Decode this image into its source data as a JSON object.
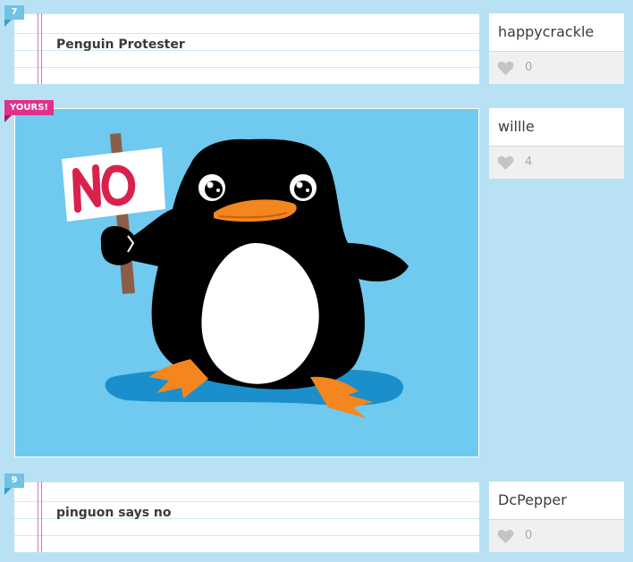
{
  "entries": [
    {
      "badge": "7",
      "caption": "Penguin Protester",
      "username": "happycrackle",
      "likes": "0"
    },
    {
      "badge": "YOURS!",
      "drawing_sign_text": "NO",
      "username": "willle",
      "likes": "4"
    },
    {
      "badge": "9",
      "caption": "pinguon says no",
      "username": "DcPepper",
      "likes": "0"
    }
  ],
  "colors": {
    "background": "#b8e2f4",
    "number_badge": "#6fc3e3",
    "yours_badge": "#e2308a",
    "drawing_sky": "#70c9ee"
  },
  "icons": {
    "like": "heart-icon"
  }
}
